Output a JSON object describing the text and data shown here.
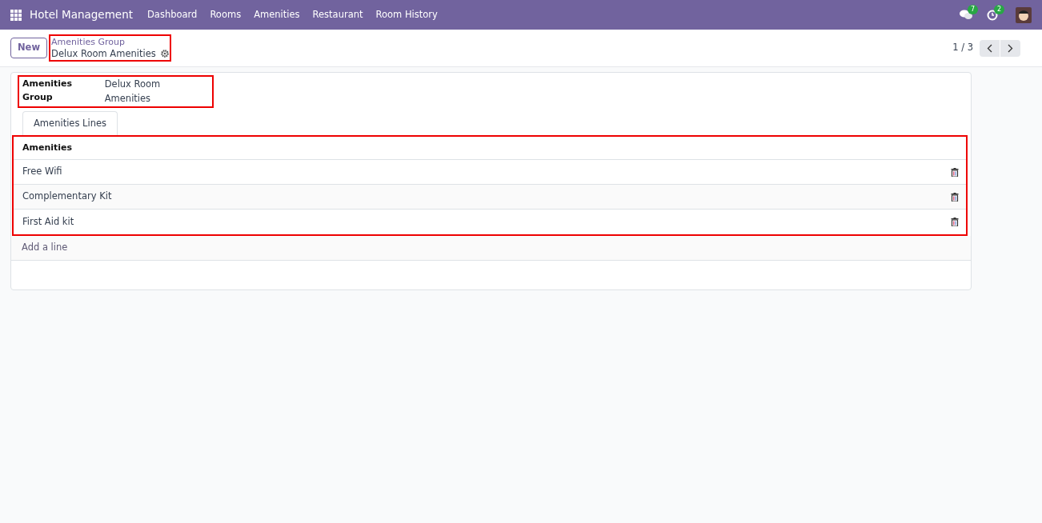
{
  "navbar": {
    "app_name": "Hotel Management",
    "menu": [
      {
        "label": "Dashboard"
      },
      {
        "label": "Rooms"
      },
      {
        "label": "Amenities"
      },
      {
        "label": "Restaurant"
      },
      {
        "label": "Room History"
      }
    ],
    "messages_count": "7",
    "activities_count": "2"
  },
  "control_panel": {
    "new_button": "New",
    "breadcrumb": "Amenities Group",
    "record_name": "Delux Room Amenities",
    "pager": "1 / 3"
  },
  "form": {
    "field_label": "Amenities Group",
    "field_value": "Delux Room Amenities",
    "tabs": [
      {
        "label": "Amenities Lines",
        "selected": true
      }
    ],
    "table": {
      "column": "Amenities",
      "rows": [
        {
          "name": "Free Wifi"
        },
        {
          "name": "Complementary Kit"
        },
        {
          "name": "First Aid kit"
        }
      ],
      "add_line": "Add a line"
    }
  }
}
